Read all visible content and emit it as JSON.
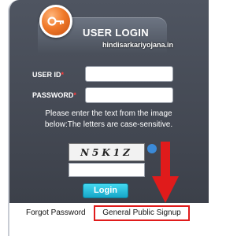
{
  "header": {
    "title": "USER LOGIN",
    "watermark": "hindisarkariyojana.in"
  },
  "form": {
    "user_id_label": "USER ID",
    "password_label": "PASSWORD",
    "required_mark": "*",
    "user_id_value": "",
    "password_value": "",
    "instructions": "Please enter the text from the image below:The letters are case-sensitive.",
    "captcha_text": "N5K1Z",
    "captcha_value": "",
    "login_label": "Login"
  },
  "links": {
    "forgot_password": "Forgot Password",
    "general_public_signup": "General Public Signup"
  },
  "colors": {
    "panel": "#444953",
    "accent_orange": "#f07a2a",
    "login_button": "#1fb8d8",
    "highlight_red": "#e01b1b"
  },
  "icons": {
    "header": "key-icon",
    "captcha_refresh": "refresh-icon",
    "annotation": "red-arrow-icon"
  }
}
